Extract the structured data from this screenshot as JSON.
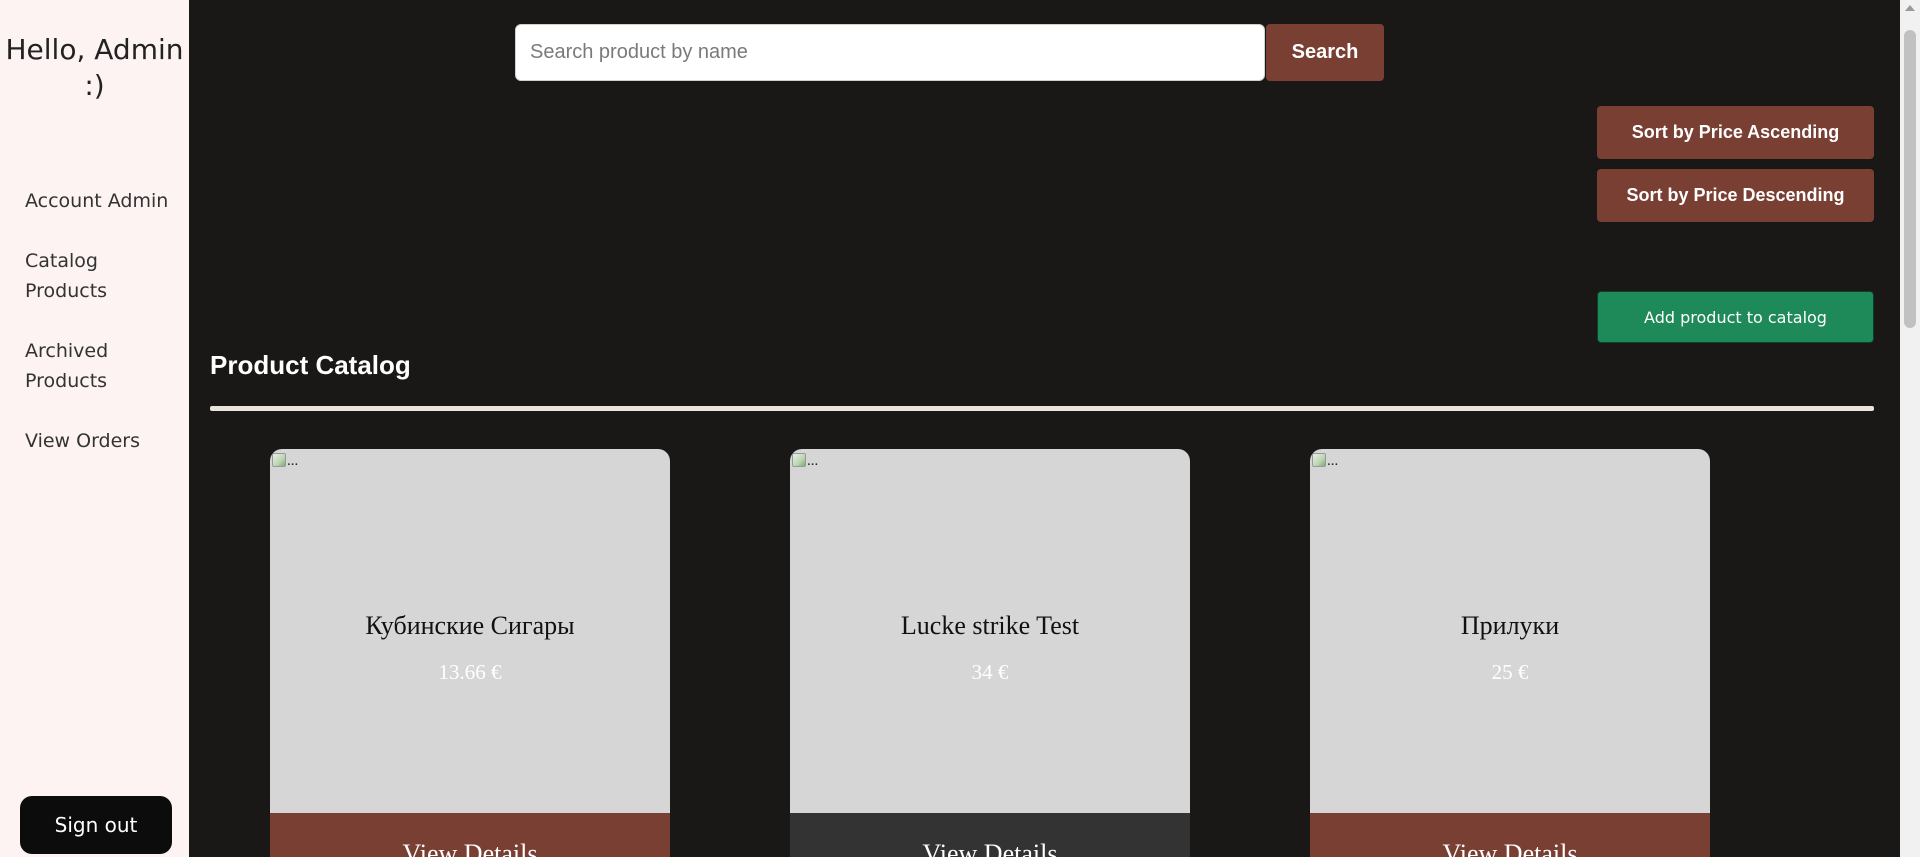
{
  "sidebar": {
    "greeting": "Hello, Admin :)",
    "items": [
      {
        "label": "Account Admin"
      },
      {
        "label": "Catalog Products"
      },
      {
        "label": "Archived Products"
      },
      {
        "label": "View Orders"
      }
    ],
    "signout_label": "Sign out"
  },
  "search": {
    "placeholder": "Search product by name",
    "value": "",
    "button_label": "Search"
  },
  "sort": {
    "ascending_label": "Sort by Price Ascending",
    "descending_label": "Sort by Price Descending"
  },
  "add_product_label": "Add product to catalog",
  "catalog": {
    "title": "Product Catalog",
    "products": [
      {
        "image_alt": "...",
        "name": "Кубинские Сигары",
        "price": "13.66 €",
        "button_label": "View Details",
        "button_color": "#7a3f33"
      },
      {
        "image_alt": "...",
        "name": "Lucke strike Test",
        "price": "34 €",
        "button_label": "View Details",
        "button_color": "#333333"
      },
      {
        "image_alt": "...",
        "name": "Прилуки",
        "price": "25 €",
        "button_label": "View Details",
        "button_color": "#7a3f33"
      }
    ]
  },
  "colors": {
    "background": "#1a1817",
    "sidebar": "#fdf3f2",
    "accent_brown": "#7a3f33",
    "add_green": "#1e8a59",
    "card": "#d6d6d6"
  }
}
